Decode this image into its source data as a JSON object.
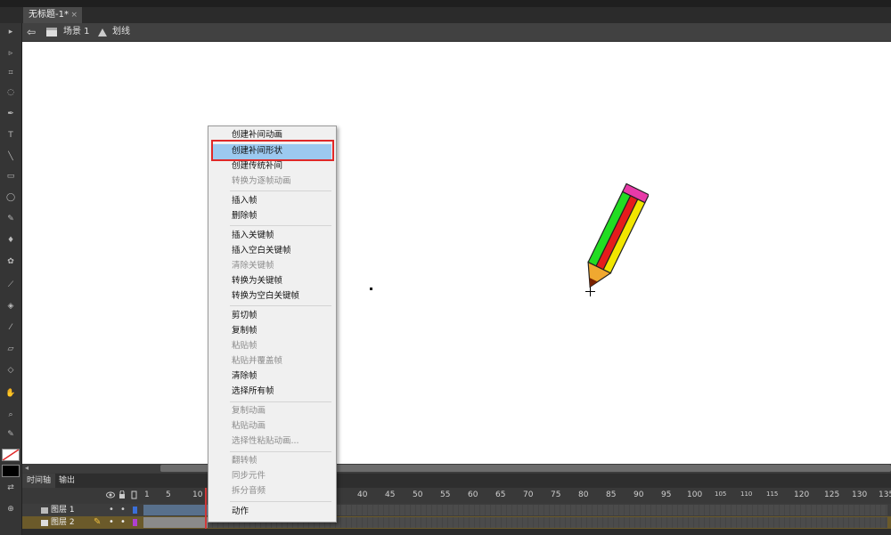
{
  "document": {
    "tab_title": "无标题-1*",
    "close_glyph": "×"
  },
  "breadcrumb": {
    "scene_label": "场景 1",
    "symbol_label": "划线"
  },
  "timeline": {
    "tabs": [
      "时间轴",
      "输出"
    ],
    "ruler": [
      "1",
      "5",
      "10",
      "40",
      "45",
      "50",
      "55",
      "60",
      "65",
      "70",
      "75",
      "80",
      "85",
      "90",
      "95",
      "100",
      "105",
      "110",
      "115",
      "120",
      "125",
      "130",
      "135"
    ],
    "layers": [
      {
        "name": "图层 1",
        "active": false
      },
      {
        "name": "图层 2",
        "active": true
      }
    ]
  },
  "context_menu": {
    "items": [
      {
        "label": "创建补间动画",
        "enabled": true
      },
      {
        "label": "创建补间形状",
        "enabled": true,
        "highlighted": true
      },
      {
        "label": "创建传统补间",
        "enabled": true
      },
      {
        "label": "转换为逐帧动画",
        "enabled": false
      },
      {
        "label": "插入帧",
        "enabled": true
      },
      {
        "label": "删除帧",
        "enabled": true
      },
      {
        "label": "插入关键帧",
        "enabled": true
      },
      {
        "label": "插入空白关键帧",
        "enabled": true
      },
      {
        "label": "清除关键帧",
        "enabled": false
      },
      {
        "label": "转换为关键帧",
        "enabled": true
      },
      {
        "label": "转换为空白关键帧",
        "enabled": true
      },
      {
        "label": "剪切帧",
        "enabled": true
      },
      {
        "label": "复制帧",
        "enabled": true
      },
      {
        "label": "粘贴帧",
        "enabled": false
      },
      {
        "label": "粘贴并覆盖帧",
        "enabled": false
      },
      {
        "label": "清除帧",
        "enabled": true
      },
      {
        "label": "选择所有帧",
        "enabled": true
      },
      {
        "label": "复制动画",
        "enabled": false
      },
      {
        "label": "粘贴动画",
        "enabled": false
      },
      {
        "label": "选择性粘贴动画...",
        "enabled": false
      },
      {
        "label": "翻转帧",
        "enabled": false
      },
      {
        "label": "同步元件",
        "enabled": false
      },
      {
        "label": "拆分音频",
        "enabled": false
      },
      {
        "label": "动作",
        "enabled": true
      }
    ]
  },
  "colors": {
    "highlight": "#9cc9ef",
    "annotation": "#e02828",
    "stage": "#ffffff"
  },
  "icons": [
    "back-arrow-icon",
    "scene-icon",
    "symbol-icon",
    "pencil-cursor-icon",
    "eye-icon",
    "lock-icon",
    "outline-icon",
    "layer-icon"
  ]
}
